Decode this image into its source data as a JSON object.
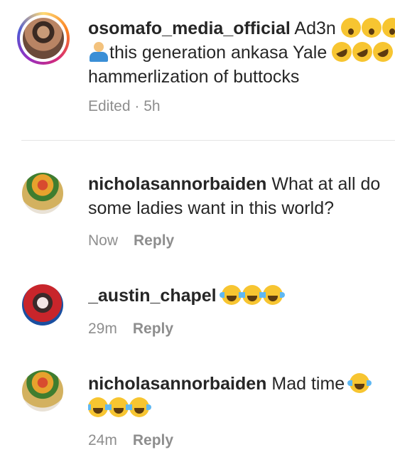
{
  "comments": [
    {
      "username": "osomafo_media_official",
      "lines": [
        "Ad3n",
        "this generation ankasa Yale",
        "hammerlization of buttocks"
      ],
      "time": "Edited · 5h"
    },
    {
      "username": "nicholasannorbaiden",
      "lines": [
        "What at all do",
        "some ladies want in this world?"
      ],
      "time": "Now",
      "reply": "Reply"
    },
    {
      "username": "_austin_chapel",
      "time": "29m",
      "reply": "Reply"
    },
    {
      "username": "nicholasannorbaiden",
      "lines": [
        "Mad time"
      ],
      "time": "24m",
      "reply": "Reply"
    }
  ],
  "icons": {
    "surprised": "astonished-face-emoji-icon",
    "shrug": "person-shrugging-emoji-icon",
    "rofl": "rolling-on-floor-laughing-emoji-icon",
    "joy": "face-with-tears-of-joy-emoji-icon"
  },
  "colors": {
    "text": "#262626",
    "meta": "#8e8e8e",
    "divider": "#e4e4e4"
  }
}
